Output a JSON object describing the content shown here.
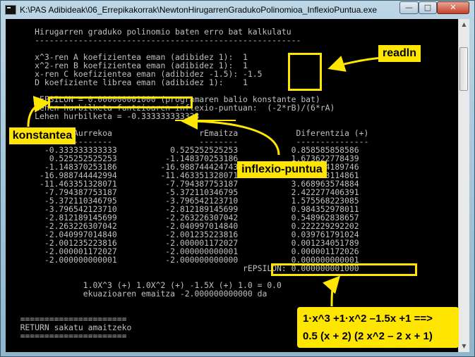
{
  "window": {
    "title": "K:\\PAS Adibideak\\06_Errepikakorrak\\NewtonHirugarrenGradukoPolinomioa_InflexioPuntua.exe",
    "controls": {
      "minimize": "—",
      "maximize": "□",
      "close": "✕"
    }
  },
  "console": {
    "lines": [
      "      Hirugarren graduko polinomio baten erro bat kalkulatu",
      "      -------------------------------------------------------",
      "",
      "      x^3-ren A koefizientea eman (adibidez 1):  1",
      "      x^2-ren B koefizientea eman (adibidez 1):  1",
      "      x-ren C koefizientea eman (adibidez -1.5): -1.5",
      "      D koefiziente librea eman (adibidez 1):    1",
      "",
      "      rEPSILON = 0.000000001000 (programaren balio konstante bat)",
      "      Lehen hurbilketa funtzioaren inflexio-puntuan:  (-2*rB)/(6*rA)",
      "      Lehen hurbilketa = -0.333333333333",
      "",
      "             rAurrekoa                  rEmaitza            Diferentzia (+)",
      "             ---------                  --------            ---------------",
      "        -0.333333333333           0.525252525253           0.858585858586",
      "         0.525252525253          -1.148370253186           1.673622778439",
      "        -1.148370253186         -16.988744424743          15.840374189746",
      "       -16.988744442994         -11.463351328071           5.525393114861",
      "       -11.463351328071          -7.794387753187           3.668963574884",
      "        -7.794387753187          -5.372110346795           2.422277406391",
      "        -5.372110346795          -3.796542123710           1.575568223085",
      "        -3.796542123710          -2.812189145699           0.984352978011",
      "        -2.812189145699          -2.263226307042           0.548962838657",
      "        -2.263226307042          -2.040997014840           0.222229292202",
      "        -2.040997014840          -2.001235223816           0.039761791024",
      "        -2.001235223816          -2.000001172027           0.001234051789",
      "        -2.000001172027          -2.000000000001           0.000001172026",
      "        -2.000000000001          -2.000000000000           0.000000000001",
      "                                                 rEPSILON: 0.000000001000",
      "",
      "                1.0X^3 (+) 1.0X^2 (+) -1.5X (+) 1.0 = 0.0",
      "                ekuazioaren emaitza -2.000000000000 da",
      "",
      "",
      "   ======================",
      "   RETURN sakatu amaitzeko",
      "   ======================"
    ]
  },
  "annotations": {
    "readln": "readln",
    "konstantea": "konstantea",
    "inflexio": "inflexio-puntua",
    "equation_line1": "1·x^3 +1·x^2 –1.5x +1   ==>",
    "equation_line2": "0.5 (x + 2) (2 x^2 – 2 x + 1)"
  },
  "colors": {
    "highlight": "#ffe600",
    "console_bg": "#000000",
    "console_text": "#c0c0c0"
  }
}
